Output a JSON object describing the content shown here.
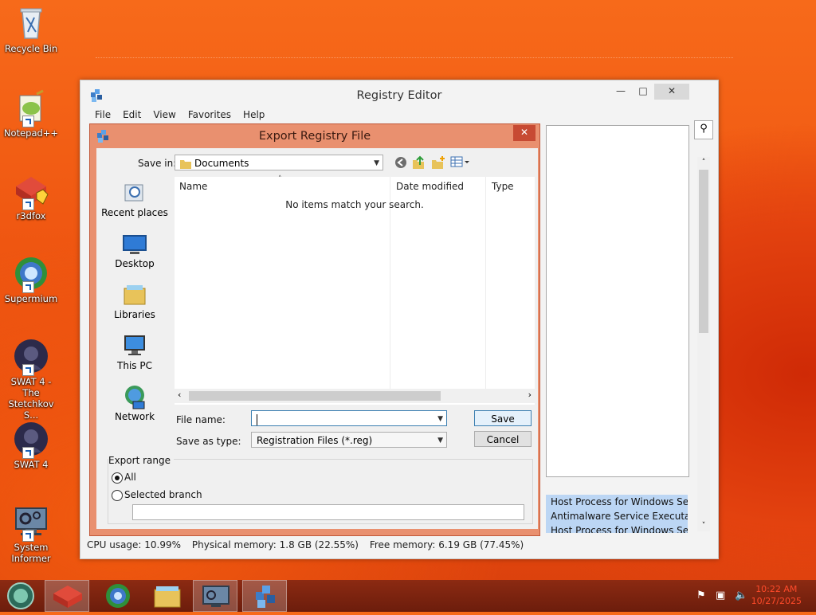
{
  "desktop": {
    "icons": [
      {
        "label": "Recycle Bin",
        "icon": "recycle-bin-icon"
      },
      {
        "label": "Notepad++",
        "icon": "notepad-plus-plus-icon"
      },
      {
        "label": "r3dfox",
        "icon": "r3dfox-icon"
      },
      {
        "label": "Supermium",
        "icon": "supermium-icon"
      },
      {
        "label": "SWAT 4 - The Stetchkov S...",
        "icon": "swat4-stetchkov-icon"
      },
      {
        "label": "SWAT 4",
        "icon": "swat4-icon"
      },
      {
        "label": "System Informer",
        "icon": "system-informer-icon"
      }
    ]
  },
  "regedit": {
    "title": "Registry Editor",
    "menu": [
      "File",
      "Edit",
      "View",
      "Favorites",
      "Help"
    ],
    "processes": [
      "Host Process for Windows Ser...",
      "Antimalware Service Executable",
      "Host Process for Windows Ser..."
    ],
    "status": {
      "cpu": "CPU usage: 10.99%",
      "physical": "Physical memory: 1.8 GB (22.55%)",
      "free": "Free memory: 6.19 GB (77.45%)"
    }
  },
  "dialog": {
    "title": "Export Registry File",
    "save_in_label": "Save in:",
    "save_in_value": "Documents",
    "places": [
      "Recent places",
      "Desktop",
      "Libraries",
      "This PC",
      "Network"
    ],
    "columns": [
      "Name",
      "Date modified",
      "Type"
    ],
    "empty_message": "No items match your search.",
    "file_name_label": "File name:",
    "file_name_value": "",
    "save_as_type_label": "Save as type:",
    "save_as_type_value": "Registration Files (*.reg)",
    "save_label": "Save",
    "cancel_label": "Cancel",
    "export_range_label": "Export range",
    "range_all": "All",
    "range_selected": "Selected branch",
    "selected_range": "All"
  },
  "taskbar": {
    "clock_time": "10:22 AM",
    "clock_date": "10/27/2025",
    "apps": [
      "start-orb-icon",
      "r3dfox-icon",
      "supermium-icon",
      "file-explorer-icon",
      "system-informer-icon",
      "regedit-icon"
    ]
  },
  "colors": {
    "dialog_frame": "#e9906f",
    "close_button": "#c74a33",
    "taskbar": "#7a2310",
    "selection_blue": "#bcd6f4"
  }
}
